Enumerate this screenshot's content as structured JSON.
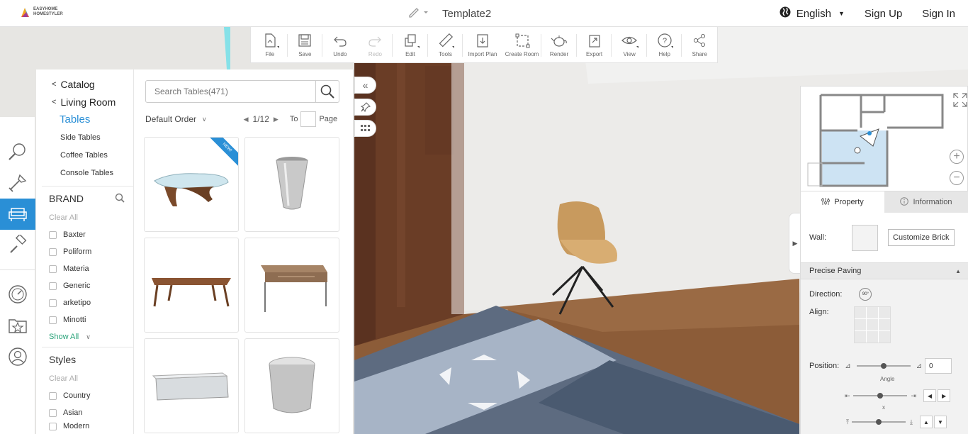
{
  "header": {
    "logo_line1": "EASYHOME",
    "logo_line2": "HOMESTYLER",
    "doc_title": "Template2",
    "language": "English",
    "sign_up": "Sign Up",
    "sign_in": "Sign In"
  },
  "toolbar": {
    "file": "File",
    "save": "Save",
    "undo": "Undo",
    "redo": "Redo",
    "edit": "Edit",
    "tools": "Tools",
    "import_plan": "Import Plan",
    "create_room": "Create Room",
    "render": "Render",
    "export": "Export",
    "view": "View",
    "help": "Help",
    "share": "Share"
  },
  "catalog": {
    "crumb_catalog": "Catalog",
    "crumb_room": "Living Room",
    "current": "Tables",
    "subcategories": [
      "Side Tables",
      "Coffee Tables",
      "Console Tables"
    ],
    "brand_title": "BRAND",
    "clear_all": "Clear All",
    "brands": [
      "Baxter",
      "Poliform",
      "Materia",
      "Generic",
      "arketipo",
      "Minotti"
    ],
    "show_all": "Show All",
    "styles_title": "Styles",
    "styles": [
      "Country",
      "Asian",
      "Modern"
    ],
    "search_placeholder": "Search Tables(471)",
    "sort": "Default Order",
    "page_indicator": "1/12",
    "to_label": "To",
    "page_label": "Page",
    "new_badge": "NEW!"
  },
  "properties": {
    "tab_property": "Property",
    "tab_information": "Information",
    "wall_label": "Wall:",
    "customize_brick": "Customize Brick",
    "precise_paving": "Precise Paving",
    "direction_label": "Direction:",
    "direction_value": "90°",
    "align_label": "Align:",
    "position_label": "Position:",
    "angle_label": "Angle",
    "angle_value": "0",
    "x_label": "x"
  },
  "colors": {
    "accent": "#2a8fd6",
    "show_all": "#2aa37a"
  }
}
